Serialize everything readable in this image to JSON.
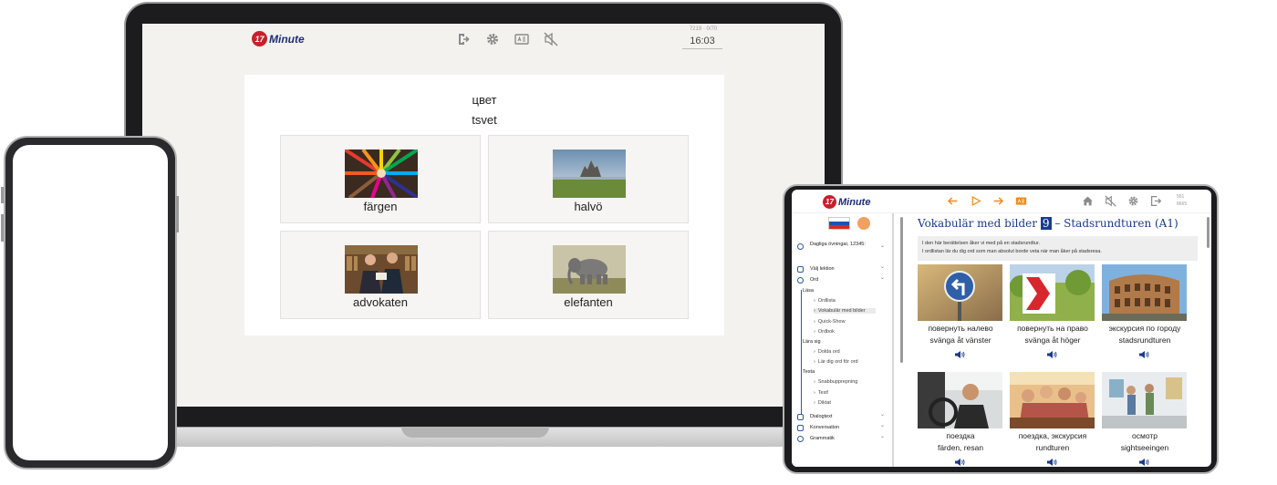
{
  "laptop": {
    "logo": {
      "number": "17",
      "text": "Minute"
    },
    "toolbar_icons": [
      "exit-icon",
      "gear-icon",
      "card-icon",
      "mute-icon"
    ],
    "stats": "7219 · 0/70",
    "time": "16:03",
    "question": {
      "word": "цвет",
      "transliteration": "tsvet"
    },
    "options": [
      {
        "label": "färgen",
        "image": "colored-pencils"
      },
      {
        "label": "halvö",
        "image": "island-landscape"
      },
      {
        "label": "advokaten",
        "image": "lawyers"
      },
      {
        "label": "elefanten",
        "image": "elephant"
      }
    ]
  },
  "tablet": {
    "logo": {
      "number": "17",
      "text": "Minute"
    },
    "nav_icons": [
      "arrow-left-icon",
      "play-icon",
      "arrow-right-icon",
      "card-icon"
    ],
    "right_icons": [
      "home-icon",
      "mute-icon",
      "gear-icon",
      "logout-icon"
    ],
    "stats": {
      "line1": "561",
      "line2": "8665"
    },
    "sidebar": {
      "daily": "Dagliga övningar, 12345:",
      "choose_lesson": "Välj lektion",
      "words": "Ord",
      "read": "Läsa",
      "read_items": [
        "Ordlista",
        "Vokabulär med bilder",
        "Quick-Show",
        "Ordbok"
      ],
      "learn": "Lära sig",
      "learn_items": [
        "Dolda ord",
        "Lär dig ord för ord"
      ],
      "test": "Testa",
      "test_items": [
        "Snabbupprepning",
        "Test!",
        "Diktat"
      ],
      "dialog": "Dialogtext",
      "conversation": "Konversation",
      "grammar": "Grammatik"
    },
    "title_prefix": "Vokabulär med bilder",
    "title_number": "9",
    "title_suffix": "– Stadsrundturen (A1)",
    "intro_line1": "I den här berättelsen åker vi med på en stadsrundtur.",
    "intro_line2": "I ordlistan lär du dig ord som man absolut borde veta när man åker på stadsresa.",
    "cards": [
      {
        "ru": "повернуть налево",
        "sv": "svänga åt vänster"
      },
      {
        "ru": "повернуть на право",
        "sv": "svänga åt höger"
      },
      {
        "ru": "экскурсия по городу",
        "sv": "stadsrundturen"
      },
      {
        "ru": "поездка",
        "sv": "färden, resan"
      },
      {
        "ru": "поездка, экскурсия",
        "sv": "rundturen"
      },
      {
        "ru": "осмотр",
        "sv": "sightseeingen"
      }
    ]
  }
}
